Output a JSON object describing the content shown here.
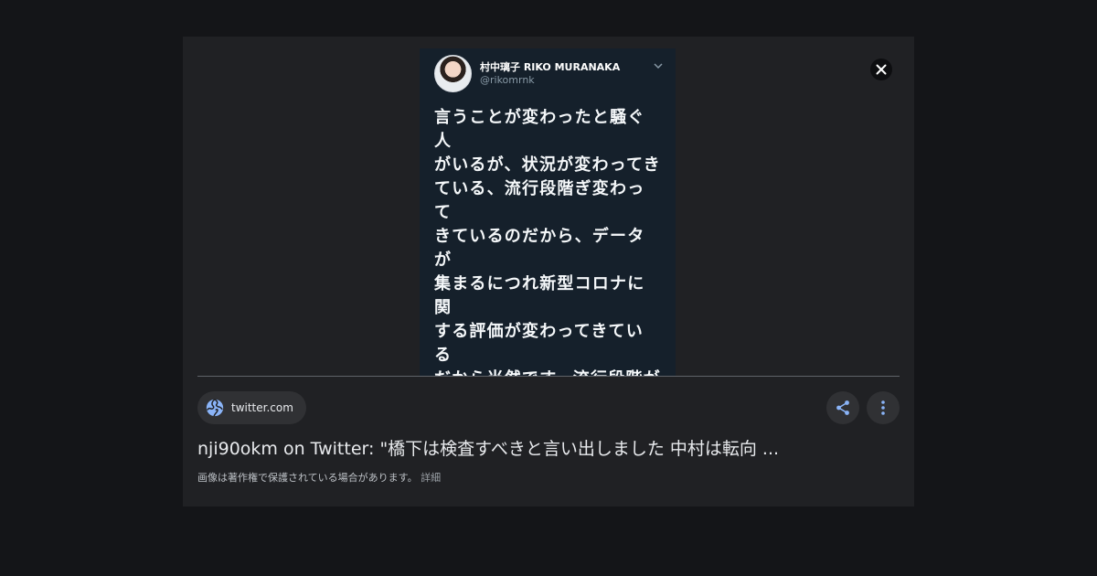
{
  "tweet": {
    "name": "村中璃子  RIKO MURANAKA",
    "handle": "@rikomrnk",
    "body": "言うことが変わったと騒ぐ人\nがいるが、状況が変わってき\nている、流行段階ぎ変わって\nきているのだから、データが\n集まるにつれ新型コロナに関\nする評価が変わってきている\nだから当然です。流行段階が\n進んでるのに、新しいデータ\nが出てきているのに、ずっと\n同じことやれと言っている人\nは素人です。"
  },
  "source": {
    "domain": "twitter.com",
    "icon": "globe-icon"
  },
  "result": {
    "title": "nji90okm on Twitter: \"橋下は検査すべきと言い出しました 中村は転向 ..."
  },
  "notice": {
    "text": "画像は著作権で保護されている場合があります。",
    "link": "詳細"
  },
  "actions": {
    "close_icon": "close-icon",
    "share_icon": "share-icon",
    "more_icon": "more-vert-icon"
  },
  "colors": {
    "page_background": "#141518",
    "panel_background": "#202124",
    "chip_background": "#303134",
    "accent_blue": "#8ab4f8",
    "tweet_background": "#15202b"
  }
}
